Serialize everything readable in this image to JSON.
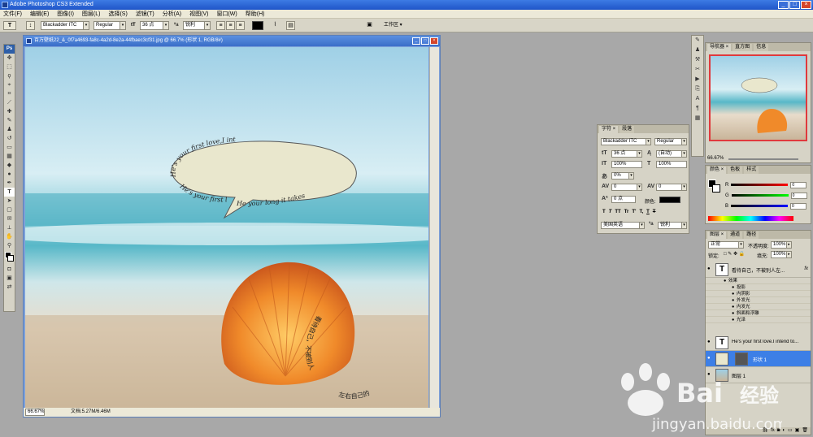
{
  "app": {
    "title": "Adobe Photoshop CS3 Extended"
  },
  "window_buttons": [
    "_",
    "□",
    "×"
  ],
  "menu": [
    "文件(F)",
    "编辑(E)",
    "图像(I)",
    "图层(L)",
    "选择(S)",
    "滤镜(T)",
    "分析(A)",
    "视图(V)",
    "窗口(W)",
    "帮助(H)"
  ],
  "options": {
    "font_family": "Blackadder ITC",
    "font_style": "Regular",
    "font_size": "36 点",
    "antialias": "锐利",
    "workspace": "工作区 ▾"
  },
  "document": {
    "title": "百万壁纸22_&_0f7a4693-fa8c-4a2d-8e2a-44fbaec3cf31.jpg @ 66.7% (形状 1, RGB/8#)",
    "zoom": "66.67%",
    "doc_info": "文档:5.27M/6.46M",
    "bubble_text_1": "He's your first love,I intend to",
    "bubble_text_2": "He's your first love",
    "bubble_text_3": "He your long it takes",
    "shell_text_1": "看待自己，不被别人",
    "shell_text_2": "左右自己的"
  },
  "character_panel": {
    "tabs": [
      "字符 ×",
      "段落"
    ],
    "font_family": "Blackadder ITC",
    "font_style": "Regular",
    "size": "36 点",
    "leading": "(自动)",
    "vscale": "100%",
    "hscale": "100%",
    "tracking_value": "0%",
    "kerning": "0",
    "tracking": "0",
    "baseline": "0 点",
    "color_label": "颜色:",
    "styles": [
      "T",
      "T",
      "TT",
      "Tr",
      "T'",
      "T,",
      "T",
      "T"
    ],
    "language": "美国英语",
    "antialias": "锐利"
  },
  "navigator": {
    "tabs": [
      "导航器 ×",
      "直方图",
      "信息"
    ],
    "zoom": "66.67%"
  },
  "color_panel": {
    "tabs": [
      "颜色 ×",
      "色板",
      "样式"
    ],
    "r": "0",
    "g": "0",
    "b": "0",
    "r_label": "R",
    "g_label": "G",
    "b_label": "B"
  },
  "layers_panel": {
    "tabs": [
      "图层 ×",
      "通道",
      "路径"
    ],
    "blend_mode": "正常",
    "opacity_label": "不透明度:",
    "opacity": "100%",
    "lock_label": "锁定:",
    "fill_label": "填充:",
    "fill": "100%",
    "layer1_name": "看待自己，不被别人左...",
    "effects_label": "效果",
    "effects": [
      "投影",
      "内阴影",
      "外发光",
      "内发光",
      "斜面和浮雕",
      "光泽"
    ],
    "layer2_name": "He's your first love.I intend to...",
    "layer3_name": "形状 1",
    "layer4_name": "图层 1",
    "fx": "fx"
  },
  "colors": {
    "titlebar": "#2660d3",
    "selection": "#3d7fe6",
    "bubble_fill": "#e9e7cd"
  }
}
